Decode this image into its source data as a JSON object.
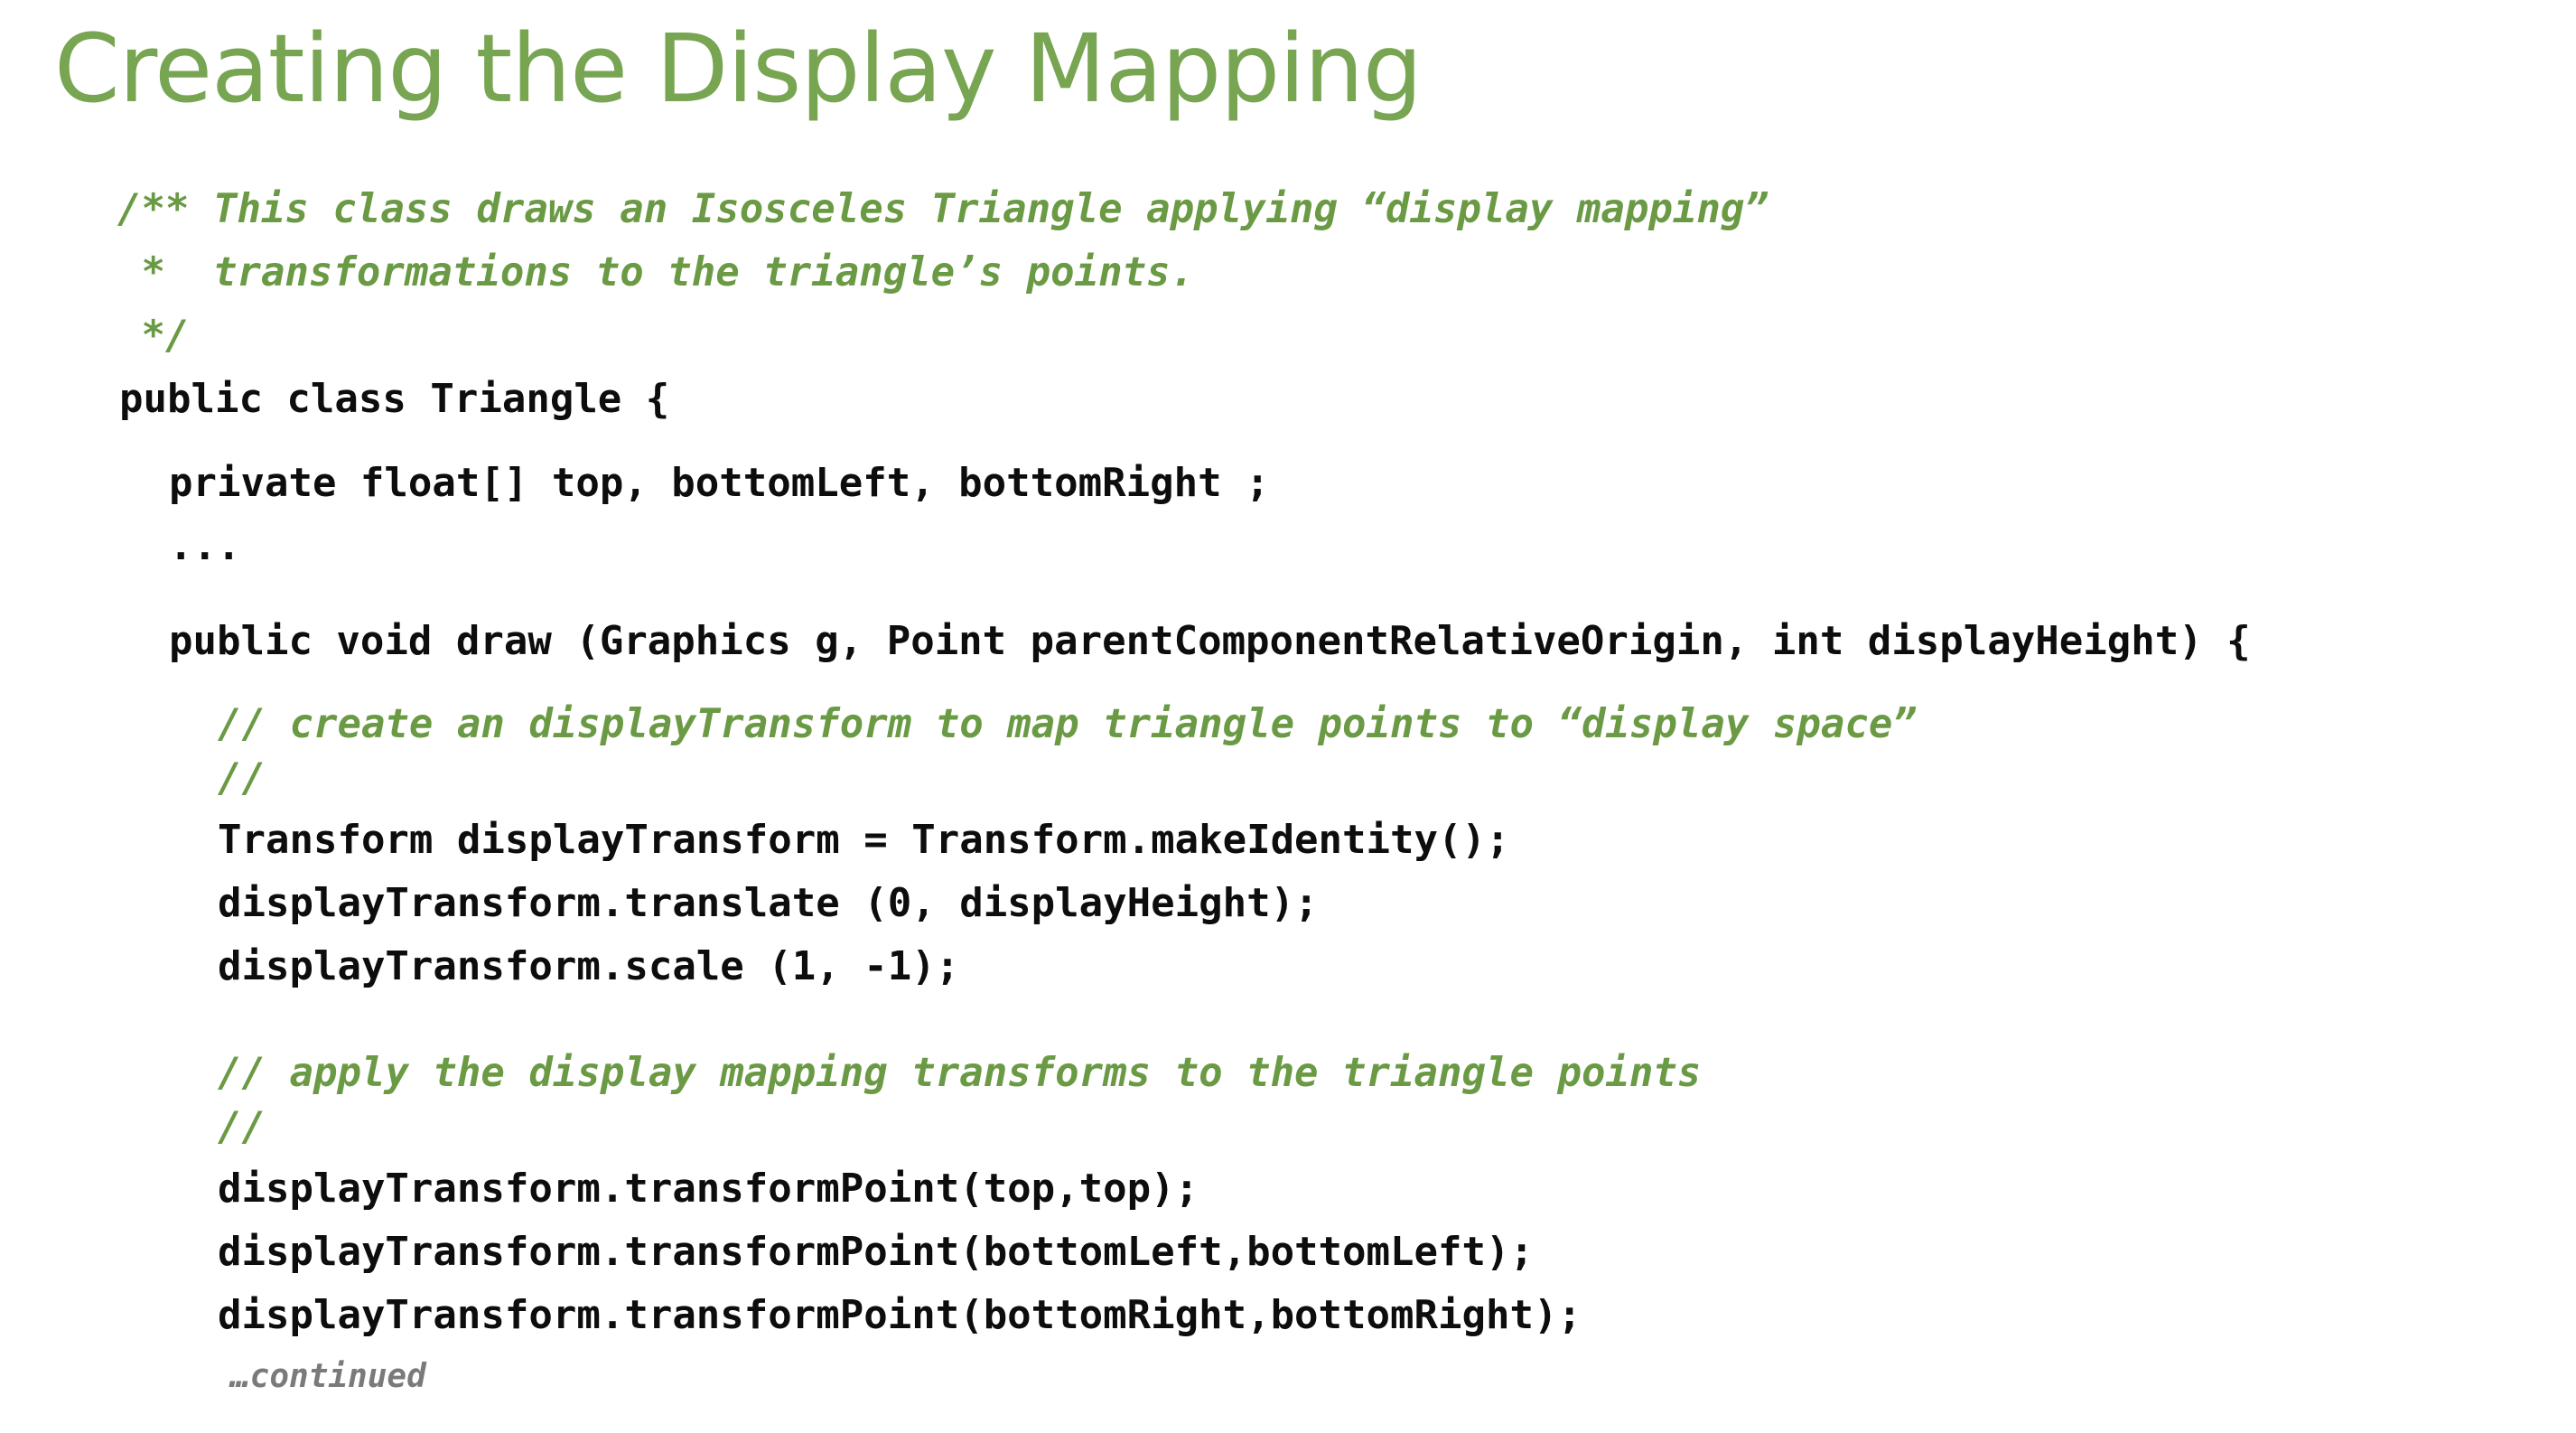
{
  "colors": {
    "title": "#77a552",
    "comment": "#6b9a45",
    "code": "#0d0d0d",
    "continued": "#7a7a7a",
    "background": "#ffffff"
  },
  "slide": {
    "title": "Creating the Display Mapping",
    "code_lines": [
      {
        "name": "doc-comment-line-1",
        "kind": "comment",
        "text": "/** This class draws an Isosceles Triangle applying “display mapping”"
      },
      {
        "name": "doc-comment-line-2",
        "kind": "comment",
        "text": " *  transformations to the triangle’s points."
      },
      {
        "name": "doc-comment-line-3",
        "kind": "comment",
        "text": " */"
      },
      {
        "name": "class-declaration-line",
        "kind": "code",
        "text": "public class Triangle {"
      },
      {
        "name": "field-declaration-line",
        "kind": "code",
        "text": "private float[] top, bottomLeft, bottomRight ;"
      },
      {
        "name": "ellipsis-line",
        "kind": "code",
        "text": "..."
      },
      {
        "name": "method-signature-line",
        "kind": "code",
        "text": "public void draw (Graphics g, Point parentComponentRelativeOrigin, int displayHeight) {"
      },
      {
        "name": "comment-create-transform-line",
        "kind": "comment",
        "text": "// create an displayTransform to map triangle points to “display space”"
      },
      {
        "name": "comment-empty-line-1",
        "kind": "comment",
        "text": "//"
      },
      {
        "name": "make-identity-line",
        "kind": "code",
        "text": "Transform displayTransform = Transform.makeIdentity();"
      },
      {
        "name": "translate-line",
        "kind": "code",
        "text": "displayTransform.translate (0, displayHeight);"
      },
      {
        "name": "scale-line",
        "kind": "code",
        "text": "displayTransform.scale (1, -1);"
      },
      {
        "name": "comment-apply-transforms-line",
        "kind": "comment",
        "text": "// apply the display mapping transforms to the triangle points"
      },
      {
        "name": "comment-empty-line-2",
        "kind": "comment",
        "text": "//"
      },
      {
        "name": "transform-top-line",
        "kind": "code",
        "text": "displayTransform.transformPoint(top,top);"
      },
      {
        "name": "transform-bottom-left-line",
        "kind": "code",
        "text": "displayTransform.transformPoint(bottomLeft,bottomLeft);"
      },
      {
        "name": "transform-bottom-right-line",
        "kind": "code",
        "text": "displayTransform.transformPoint(bottomRight,bottomRight);"
      }
    ],
    "continued_note": "…continued"
  }
}
